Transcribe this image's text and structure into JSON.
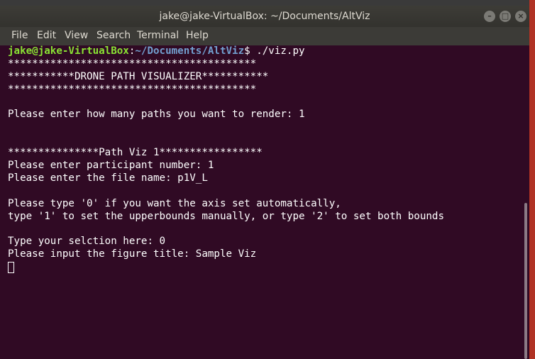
{
  "window": {
    "title": "jake@jake-VirtualBox: ~/Documents/AltViz",
    "controls": {
      "minimize": "–",
      "maximize": "□",
      "close": "×"
    }
  },
  "menubar": [
    "File",
    "Edit",
    "View",
    "Search",
    "Terminal",
    "Help"
  ],
  "terminal": {
    "prompt": {
      "user_host": "jake@jake-VirtualBox",
      "separator": ":",
      "path": "~/Documents/AltViz",
      "symbol": "$",
      "command": " ./viz.py"
    },
    "lines": [
      "*****************************************",
      "***********DRONE PATH VISUALIZER***********",
      "*****************************************",
      "",
      "Please enter how many paths you want to render: 1",
      "",
      "",
      "***************Path Viz 1*****************",
      "Please enter participant number: 1",
      "Please enter the file name: p1V_L",
      "",
      "Please type '0' if you want the axis set automatically,",
      "type '1' to set the upperbounds manually, or type '2' to set both bounds",
      "",
      "Type your selction here: 0",
      "Please input the figure title: Sample Viz"
    ]
  },
  "colors": {
    "terminal_bg": "#300a24",
    "prompt_user": "#8ae234",
    "prompt_path": "#729fcf",
    "titlebar": "#3d3c37"
  }
}
